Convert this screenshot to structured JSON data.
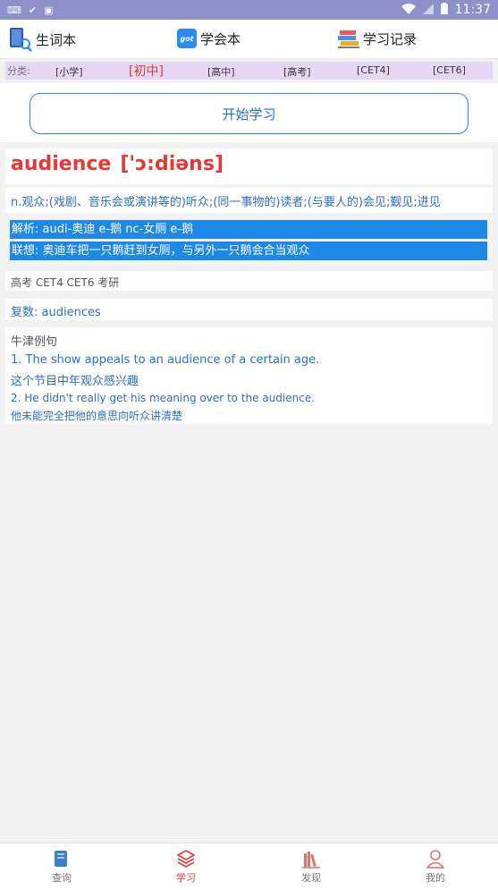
{
  "status_bar": {
    "time": "11:37",
    "left_icons": [
      "keyboard-icon",
      "check-icon",
      "a-icon"
    ],
    "right_icons": [
      "wifi-icon",
      "signal-icon",
      "battery-icon"
    ]
  },
  "top_nav": {
    "new_words": "生词本",
    "learned": "学会本",
    "records": "学习记录",
    "got_badge": "got"
  },
  "category": {
    "label": "分类:",
    "items": [
      "[小学]",
      "[初中]",
      "[高中]",
      "[高考]",
      "[CET4]",
      "[CET6]"
    ],
    "active_index": 1
  },
  "start_button": "开始学习",
  "word": {
    "text": "audience",
    "phonetic": "['ɔ:diəns]",
    "definition": "n.观众;(戏剧、音乐会或演讲等的)听众;(同一事物的)读者;(与要人的)会见;觐见;进见",
    "analysis": "解析: audi-奥迪 e-鹅 nc-女厕 e-鹅",
    "association": "联想: 奥迪车把一只鹅赶到女厕，与另外一只鹅会合当观众",
    "tags": "高考 CET4 CET6 考研",
    "plural": "复数:  audiences"
  },
  "examples": {
    "heading": "牛津例句",
    "items": [
      {
        "en": "1. The show appeals to an audience of a certain age.",
        "zh": "这个节目中年观众感兴趣"
      },
      {
        "en": "2. He didn't really get his meaning over to the audience.",
        "zh": "他未能完全把他的意思向听众讲清楚"
      }
    ]
  },
  "tabs": [
    {
      "label": "查询",
      "icon": "book-icon"
    },
    {
      "label": "学习",
      "icon": "layers-icon"
    },
    {
      "label": "发现",
      "icon": "books-icon"
    },
    {
      "label": "我的",
      "icon": "user-icon"
    }
  ],
  "active_tab": 1,
  "colors": {
    "status_bar": "#8e91c9",
    "accent_red": "#e53935",
    "accent_blue": "#2a6fc9",
    "highlight": "#1e88e5"
  }
}
